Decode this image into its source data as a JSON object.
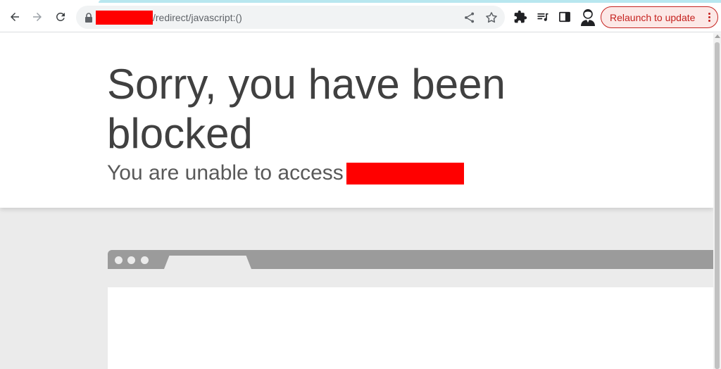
{
  "browser": {
    "address_bar": {
      "url_path": "/redirect/javascript:()"
    },
    "relaunch_label": "Relaunch to update",
    "icons": [
      "back-arrow-icon",
      "forward-arrow-icon",
      "reload-icon",
      "lock-icon",
      "share-icon",
      "star-icon",
      "extensions-icon",
      "media-queue-icon",
      "side-panel-icon",
      "profile-avatar-icon",
      "more-menu-icon"
    ],
    "colors": {
      "relaunch_accent": "#c5221f",
      "relaunch_background": "#fce8e6",
      "redaction": "#ff0000",
      "tab_strip_accent": "#b8e7ef"
    }
  },
  "page": {
    "headline": "Sorry, you have been blocked",
    "subline": "You are unable to access",
    "colors": {
      "headline_text": "#404040",
      "subline_text": "#595959",
      "illustration_gray": "#9b9b9b",
      "background_gray": "#ebebeb"
    }
  }
}
